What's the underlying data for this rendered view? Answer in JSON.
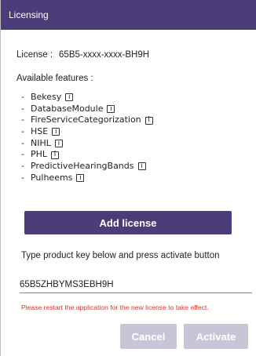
{
  "window": {
    "title": "Licensing"
  },
  "license": {
    "label": "License :",
    "value": "65B5-xxxx-xxxx-BH9H"
  },
  "features_heading": "Available features :",
  "features": [
    {
      "bullet": "-",
      "name": "Bekesy",
      "info": "i"
    },
    {
      "bullet": "-",
      "name": "DatabaseModule",
      "info": "i"
    },
    {
      "bullet": "-",
      "name": "FireServiceCategorization",
      "info": "i"
    },
    {
      "bullet": "-",
      "name": "HSE",
      "info": "i"
    },
    {
      "bullet": "-",
      "name": "NIHL",
      "info": "i"
    },
    {
      "bullet": "-",
      "name": "PHL",
      "info": "i"
    },
    {
      "bullet": "-",
      "name": "PredictiveHearingBands",
      "info": "i"
    },
    {
      "bullet": "-",
      "name": "Pulheems",
      "info": "i"
    }
  ],
  "add_license_label": "Add license",
  "activation": {
    "prompt": "Type product key below and press activate button",
    "product_key_value": "65B5ZHBYMS3EBH9H",
    "warning": "Please restart the application for the new license to take effect.",
    "cancel_label": "Cancel",
    "activate_label": "Activate"
  },
  "colors": {
    "accent": "#4a3d7a",
    "disabled_button": "#c9c5d6",
    "warning": "#d9362b"
  }
}
